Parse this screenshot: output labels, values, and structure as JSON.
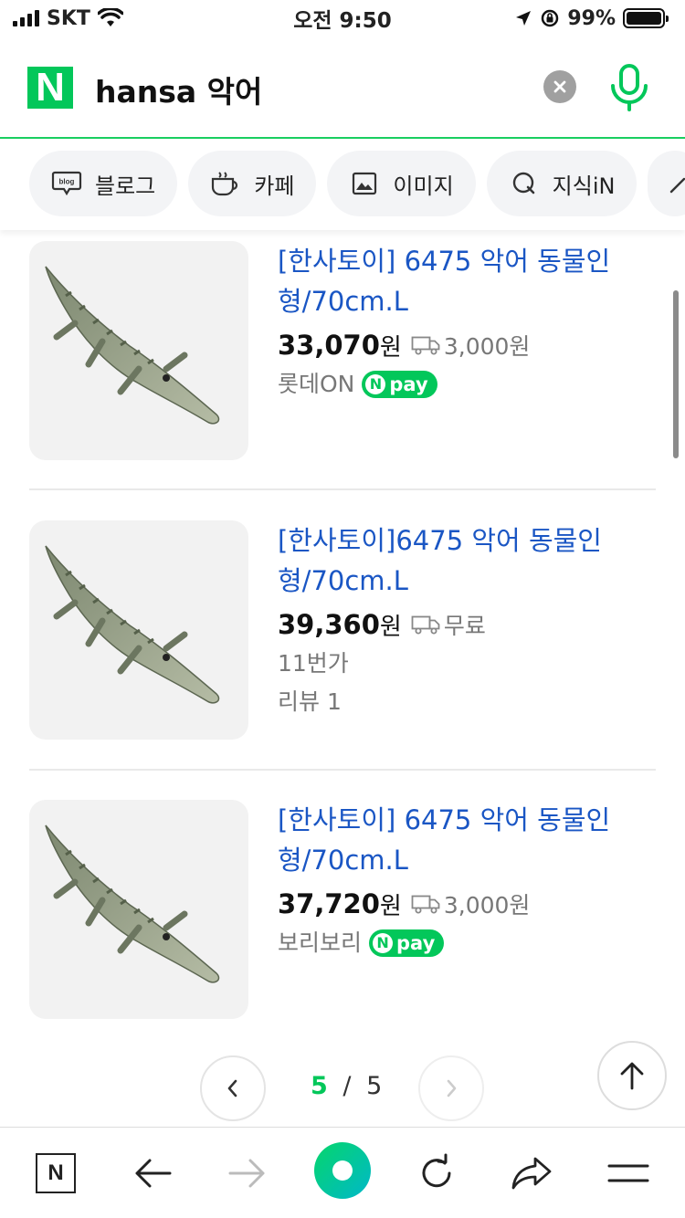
{
  "status_bar": {
    "carrier": "SKT",
    "time": "오전 9:50",
    "battery": "99%"
  },
  "search": {
    "logo": "N",
    "query": "hansa 악어"
  },
  "tabs": [
    {
      "label": "블로그",
      "icon": "blog-icon"
    },
    {
      "label": "카페",
      "icon": "cafe-cup-icon"
    },
    {
      "label": "이미지",
      "icon": "image-icon"
    },
    {
      "label": "지식iN",
      "icon": "kin-icon"
    }
  ],
  "products": [
    {
      "title": "[한사토이] 6475 악어 동물인형/70cm.L",
      "price": "33,070",
      "won": "원",
      "shipping": "3,000원",
      "seller": "롯데ON",
      "npay": "pay",
      "npay_n": "N",
      "review": ""
    },
    {
      "title": "[한사토이]6475 악어 동물인형/70cm.L",
      "price": "39,360",
      "won": "원",
      "shipping": "무료",
      "seller": "11번가",
      "npay": "",
      "npay_n": "",
      "review": "리뷰 1"
    },
    {
      "title": "[한사토이] 6475 악어 동물인형/70cm.L",
      "price": "37,720",
      "won": "원",
      "shipping": "3,000원",
      "seller": "보리보리",
      "npay": "pay",
      "npay_n": "N",
      "review": ""
    }
  ],
  "pagination": {
    "current": "5",
    "separator": "/",
    "total": "5"
  },
  "toolbar": {
    "home_label": "N"
  },
  "colors": {
    "naver_green": "#03c75a",
    "link_blue": "#1a56c4"
  }
}
